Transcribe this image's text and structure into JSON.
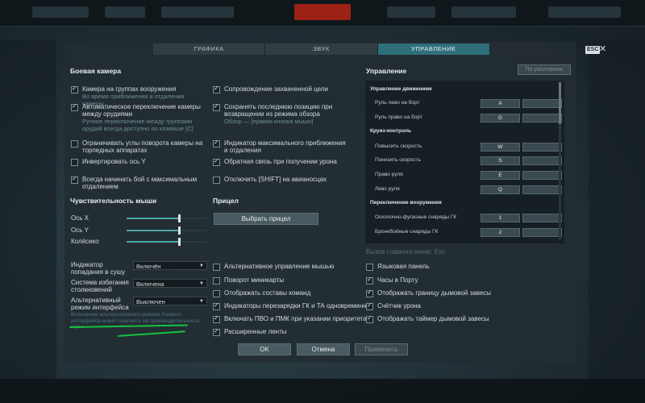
{
  "tabs": [
    "ГРАФИКА",
    "ЗВУК",
    "УПРАВЛЕНИЕ"
  ],
  "esc_label": "ESC",
  "close_icon": "close-icon",
  "camera": {
    "title": "Боевая камера",
    "left": [
      {
        "label": "Камера на группах вооружения",
        "sub": "Во время приближения и отдаления камеры",
        "checked": true
      },
      {
        "label": "Автоматическое переключение камеры между орудиями",
        "sub": "Ручное переключение между группами орудий всегда доступно по клавише [C]",
        "checked": true
      },
      {
        "label": "Ограничивать углы поворота камеры на торпедных аппаратах",
        "sub": "",
        "checked": false
      },
      {
        "label": "Инвертировать ось Y",
        "sub": "",
        "checked": false
      },
      {
        "label": "Всегда начинать бой с максимальным отдалением",
        "sub": "",
        "checked": true
      }
    ],
    "right": [
      {
        "label": "Сопровождение захваченной цели",
        "sub": "",
        "checked": true
      },
      {
        "label": "Сохранять последнюю позицию при возвращении из режима обзора",
        "sub": "Обзор — [правая кнопка мыши]",
        "checked": true
      },
      {
        "label": "Индикатор максимального приближения и отдаления",
        "sub": "",
        "checked": true
      },
      {
        "label": "Обратная связь при получении урона",
        "sub": "",
        "checked": true
      },
      {
        "label": "Отключить [SHIFT] на авианосцах",
        "sub": "",
        "checked": false
      }
    ]
  },
  "mouse": {
    "title": "Чувствительность мыши",
    "sliders": [
      {
        "label": "Ось X",
        "value": 0.65
      },
      {
        "label": "Ось Y",
        "value": 0.65
      },
      {
        "label": "Колёсико",
        "value": 0.65
      }
    ]
  },
  "sight": {
    "title": "Прицел",
    "button": "Выбрать прицел"
  },
  "dropdowns": [
    {
      "label": "Индикатор попадания в сушу",
      "value": "Включён"
    },
    {
      "label": "Система избегания столкновений",
      "value": "Включена"
    },
    {
      "label": "Альтернативный режим интерфейса",
      "value": "Выключен"
    }
  ],
  "hint": "Включение альтернативного режима боевого интерфейса может повлиять на производительность игры",
  "middle_options": [
    {
      "label": "Альтернативное управление мышью",
      "checked": false
    },
    {
      "label": "Поворот миникарты",
      "checked": false
    },
    {
      "label": "Отображать составы команд",
      "checked": false
    },
    {
      "label": "Индикаторы перезарядки ГК и ТА одновременно",
      "checked": true
    },
    {
      "label": "Включать ПВО и ПМК при указании приоритета",
      "checked": true
    },
    {
      "label": "Расширенные ленты",
      "checked": true
    }
  ],
  "right_options": [
    {
      "label": "Языковая панель",
      "checked": false
    },
    {
      "label": "Часы в Порту",
      "checked": true
    },
    {
      "label": "Отображать границу дымовой завесы",
      "checked": true
    },
    {
      "label": "Счётчик урона",
      "checked": true
    },
    {
      "label": "Отображать таймер дымовой завесы",
      "checked": true
    }
  ],
  "controls": {
    "title": "Управление",
    "default_button": "По умолчанию",
    "sections": [
      {
        "title": "Управление движением",
        "rows": [
          {
            "label": "Руль лево на борт",
            "key": "A"
          },
          {
            "label": "Руль право на борт",
            "key": "D"
          }
        ]
      },
      {
        "title": "Круиз-контроль",
        "rows": [
          {
            "label": "Повысить скорость",
            "key": "W"
          },
          {
            "label": "Понизить скорость",
            "key": "S"
          },
          {
            "label": "Право руля",
            "key": "E"
          },
          {
            "label": "Лево руля",
            "key": "Q"
          }
        ]
      },
      {
        "title": "Переключение вооружения",
        "rows": [
          {
            "label": "Осколочно-фугасные снаряды ГК",
            "key": "1"
          },
          {
            "label": "Бронебойные снаряды ГК",
            "key": "2"
          }
        ]
      }
    ],
    "main_menu_call": "Вызов главного меню: Esc"
  },
  "footer": {
    "ok": "OK",
    "cancel": "Отмена",
    "apply": "Применить"
  },
  "colors": {
    "accent": "#2f6f7a",
    "checkbox": "#d6e2e6",
    "annotation": "#17c23f"
  }
}
